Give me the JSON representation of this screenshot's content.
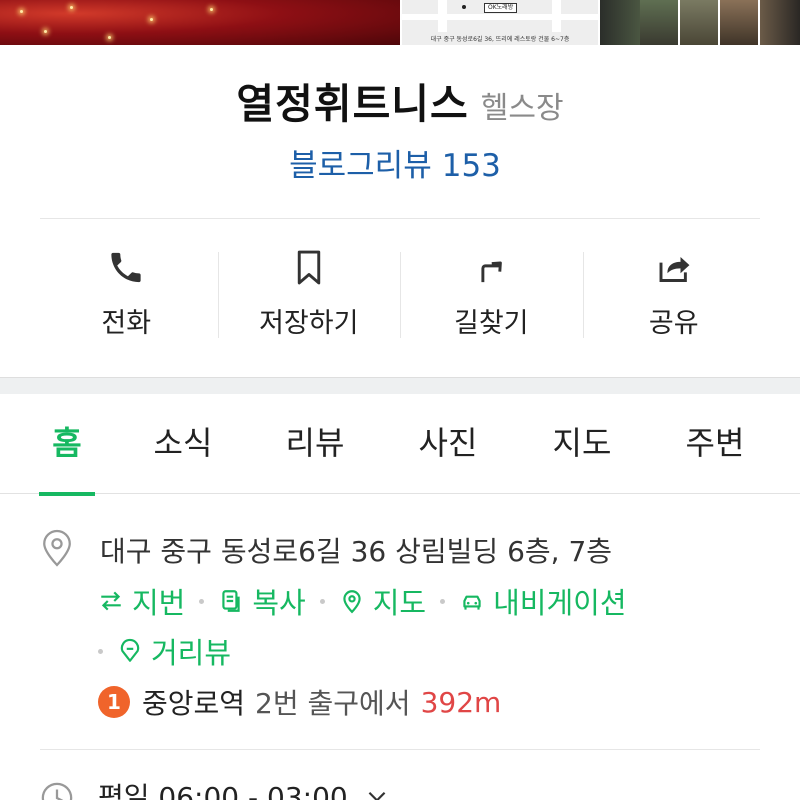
{
  "photos": {
    "map_tag": "OK노래방",
    "map_caption": "대구 중구 동성로6길 36, 뜨리에 레스토랑 건물 6~7층"
  },
  "place": {
    "name": "열정휘트니스",
    "category": "헬스장",
    "review_label": "블로그리뷰",
    "review_count": "153"
  },
  "actions": [
    {
      "label": "전화",
      "icon": "phone-icon"
    },
    {
      "label": "저장하기",
      "icon": "bookmark-icon"
    },
    {
      "label": "길찾기",
      "icon": "directions-icon"
    },
    {
      "label": "공유",
      "icon": "share-icon"
    }
  ],
  "tabs": [
    {
      "label": "홈",
      "active": true
    },
    {
      "label": "소식"
    },
    {
      "label": "리뷰"
    },
    {
      "label": "사진"
    },
    {
      "label": "지도"
    },
    {
      "label": "주변"
    }
  ],
  "info": {
    "address": "대구 중구 동성로6길 36 상림빌딩 6층, 7층",
    "links": {
      "lot": "지번",
      "copy": "복사",
      "map": "지도",
      "navigation": "내비게이션",
      "street_view": "거리뷰"
    },
    "subway": {
      "line": "1",
      "station": "중앙로역",
      "exit": "2번 출구에서",
      "distance": "392m"
    },
    "hours": "평일 06:00 - 03:00"
  },
  "colors": {
    "accent_green": "#16b861",
    "review_blue": "#1d5fa8",
    "line1_orange": "#f0642b",
    "distance_red": "#e04646"
  }
}
